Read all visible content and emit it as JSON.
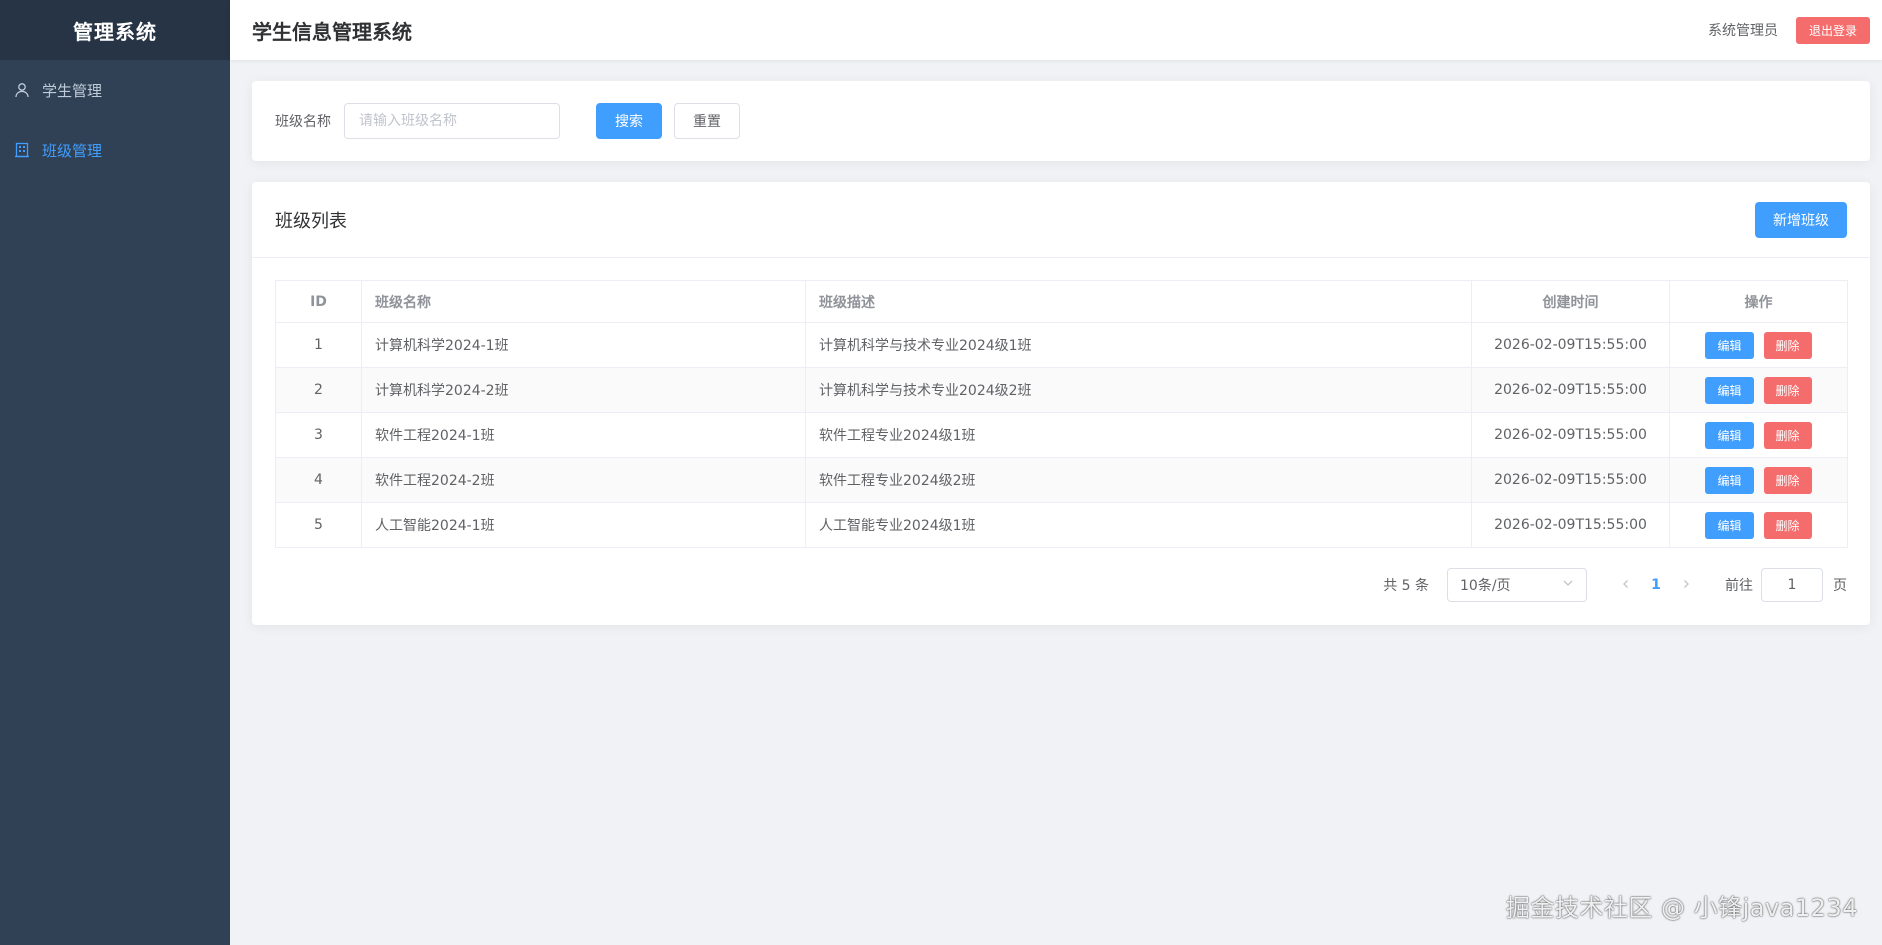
{
  "sidebar": {
    "logo": "管理系统",
    "items": [
      {
        "label": "学生管理",
        "icon": "user-icon",
        "active": false
      },
      {
        "label": "班级管理",
        "icon": "building-icon",
        "active": true
      }
    ]
  },
  "header": {
    "title": "学生信息管理系统",
    "user": "系统管理员",
    "logout_label": "退出登录"
  },
  "search": {
    "label": "班级名称",
    "placeholder": "请输入班级名称",
    "value": "",
    "search_label": "搜索",
    "reset_label": "重置"
  },
  "list": {
    "title": "班级列表",
    "add_label": "新增班级",
    "columns": [
      "ID",
      "班级名称",
      "班级描述",
      "创建时间",
      "操作"
    ],
    "edit_label": "编辑",
    "delete_label": "删除",
    "rows": [
      {
        "id": "1",
        "name": "计算机科学2024-1班",
        "desc": "计算机科学与技术专业2024级1班",
        "created": "2026-02-09T15:55:00"
      },
      {
        "id": "2",
        "name": "计算机科学2024-2班",
        "desc": "计算机科学与技术专业2024级2班",
        "created": "2026-02-09T15:55:00"
      },
      {
        "id": "3",
        "name": "软件工程2024-1班",
        "desc": "软件工程专业2024级1班",
        "created": "2026-02-09T15:55:00"
      },
      {
        "id": "4",
        "name": "软件工程2024-2班",
        "desc": "软件工程专业2024级2班",
        "created": "2026-02-09T15:55:00"
      },
      {
        "id": "5",
        "name": "人工智能2024-1班",
        "desc": "人工智能专业2024级1班",
        "created": "2026-02-09T15:55:00"
      }
    ]
  },
  "pagination": {
    "total_text": "共 5 条",
    "page_size": "10条/页",
    "current_page": "1",
    "goto_label": "前往",
    "goto_value": "1",
    "page_suffix": "页"
  },
  "watermark": "掘金技术社区 @ 小锋java1234",
  "colors": {
    "sidebar_bg": "#304156",
    "logo_bg": "#263445",
    "primary": "#409eff",
    "danger": "#f56c6c"
  }
}
